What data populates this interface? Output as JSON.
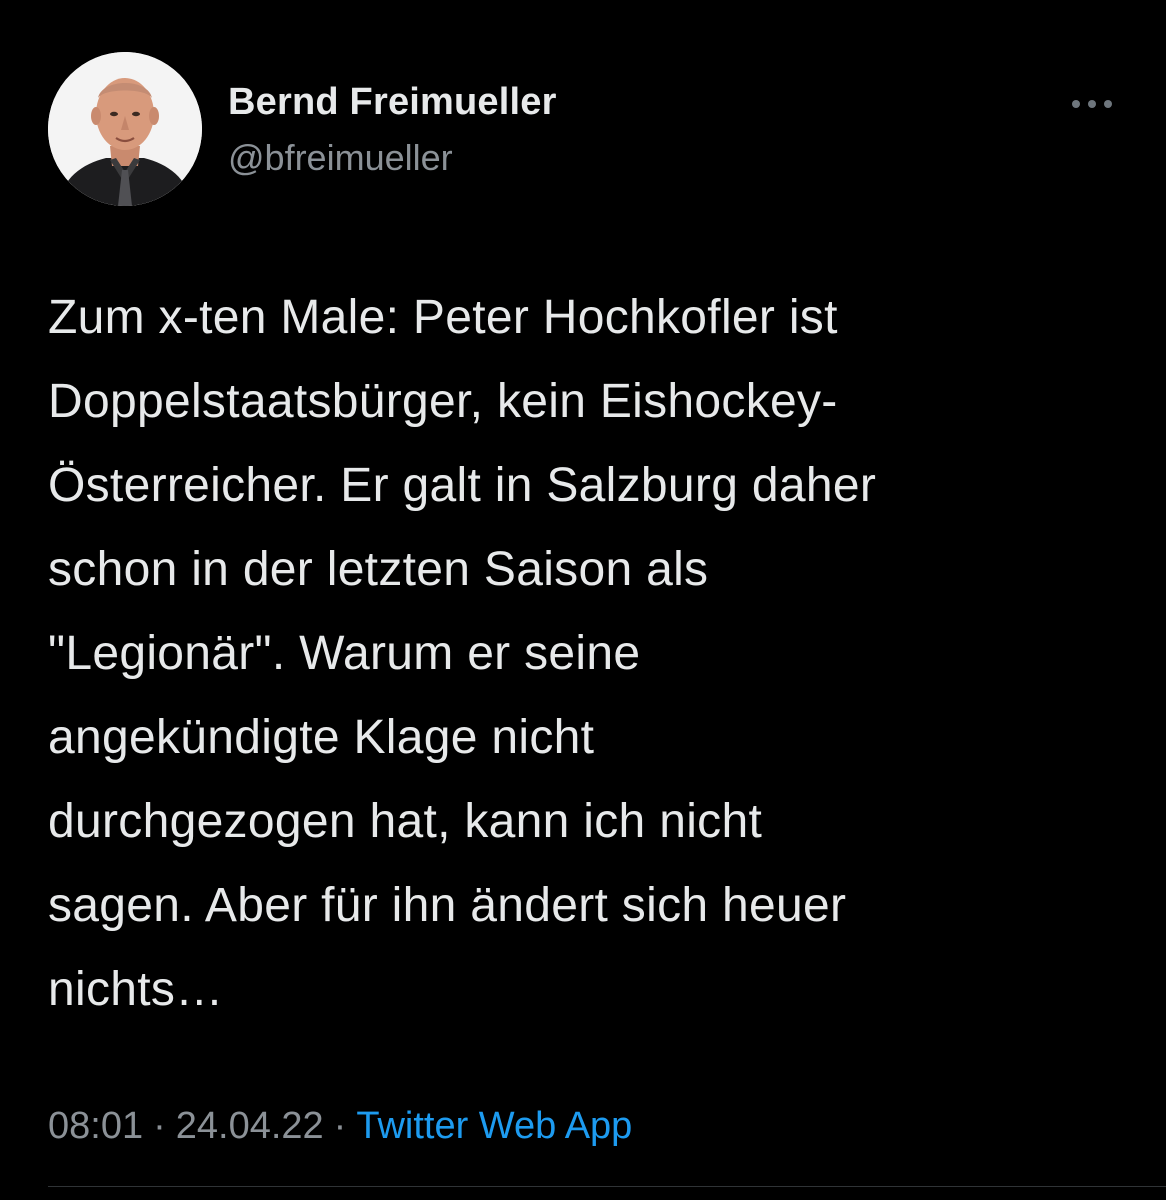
{
  "user": {
    "display_name": "Bernd Freimueller",
    "handle": "@bfreimueller",
    "avatar_icon": "profile-photo"
  },
  "more_icon": "more-horizontal-icon",
  "tweet": {
    "text": "Zum x-ten Male: Peter Hochkofler ist\nDoppelstaatsbürger, kein Eishockey-\nÖsterreicher. Er galt in Salzburg daher\nschon in der letzten Saison als\n\"Legionär\". Warum er seine\nangekündigte Klage nicht\ndurchgezogen hat, kann ich nicht\nsagen. Aber für ihn ändert sich heuer\nnichts…"
  },
  "meta": {
    "time": "08:01",
    "separator": "·",
    "date": "24.04.22",
    "source": "Twitter Web App"
  },
  "colors": {
    "background": "#000000",
    "text": "#e7e9ea",
    "secondary_text": "#8b9197",
    "link": "#1d9bf0"
  }
}
